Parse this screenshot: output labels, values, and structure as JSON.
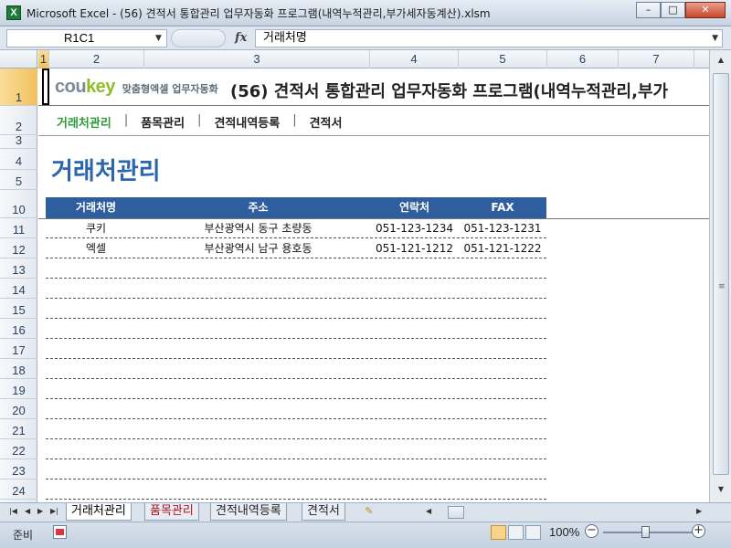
{
  "window": {
    "title": "Microsoft Excel - (56) 견적서 통합관리 업무자동화 프로그램(내역누적관리,부가세자동계산).xlsm",
    "minimize": "–",
    "maximize": "□",
    "close": "✕"
  },
  "formula_bar": {
    "name_box": "R1C1",
    "fx": "fx",
    "content": "거래처명"
  },
  "columns": [
    "1",
    "2",
    "3",
    "4",
    "5",
    "6",
    "7"
  ],
  "rows": [
    "1",
    "2",
    "3",
    "4",
    "5",
    "10",
    "11",
    "12",
    "13",
    "14",
    "15",
    "16",
    "17",
    "18",
    "19",
    "20",
    "21",
    "22",
    "23",
    "24"
  ],
  "sheet": {
    "logo_cou": "cou",
    "logo_key": "key",
    "logo_sub": "맞춤형엑셀 업무자동화",
    "title": "(56) 견적서 통합관리 업무자동화 프로그램(내역누적관리,부가",
    "nav": [
      "거래처관리",
      "품목관리",
      "견적내역등록",
      "견적서"
    ],
    "nav_sep": "|",
    "section_title": "거래처관리",
    "table": {
      "headers": [
        "거래처명",
        "주소",
        "연락처",
        "FAX"
      ],
      "rows": [
        [
          "쿠키",
          "부산광역시 동구 초량동",
          "051-123-1234",
          "051-123-1231"
        ],
        [
          "엑셀",
          "부산광역시 남구 용호동",
          "051-121-1212",
          "051-121-1222"
        ]
      ]
    }
  },
  "sheet_tabs": [
    "거래처관리",
    "품목관리",
    "견적내역등록",
    "견적서"
  ],
  "status": {
    "ready": "준비",
    "zoom": "100%"
  },
  "colors": {
    "accent": "#2f5e9e",
    "title_blue": "#2a66ad",
    "nav_active": "#2f9a3a",
    "logo_green": "#8fbd2a"
  }
}
